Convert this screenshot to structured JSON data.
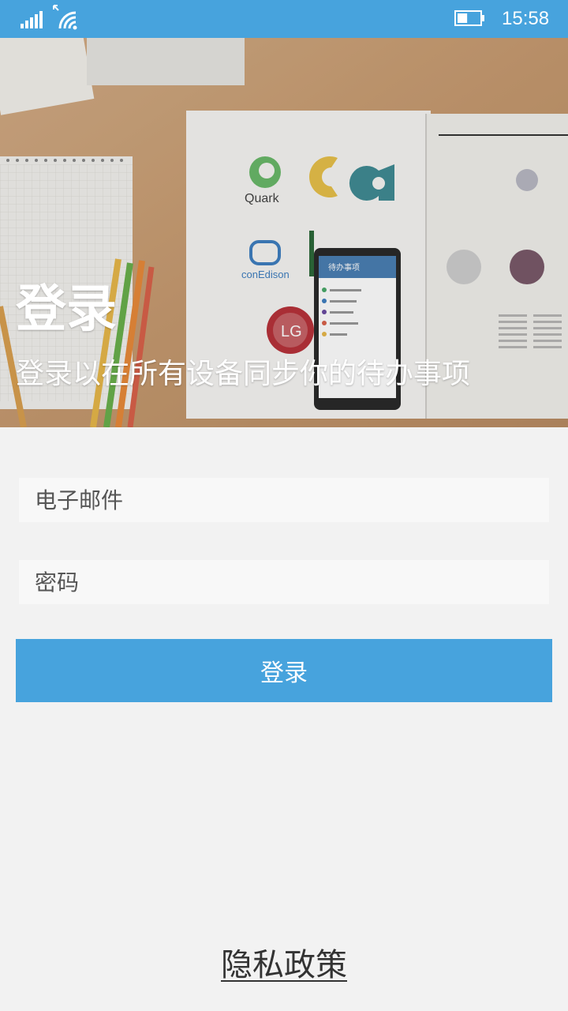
{
  "status_bar": {
    "time": "15:58",
    "signal_icon": "signal-bars-icon",
    "wifi_icon": "wifi-icon",
    "battery_icon": "battery-icon",
    "battery_level": 0.45
  },
  "hero": {
    "title": "登录",
    "subtitle": "登录以在所有设备同步你的待办事项",
    "background": "desk-photo-with-magazine-and-phone",
    "logos": {
      "quark": "Quark",
      "conedison": "conEdison",
      "lg": "LG"
    },
    "phone": {
      "app_title": "待办事项"
    }
  },
  "form": {
    "email_placeholder": "电子邮件",
    "password_placeholder": "密码",
    "login_label": "登录"
  },
  "footer": {
    "privacy_label": "隐私政策"
  },
  "colors": {
    "accent": "#47a3dd",
    "background": "#f2f2f2",
    "field_background": "#f8f8f8"
  }
}
